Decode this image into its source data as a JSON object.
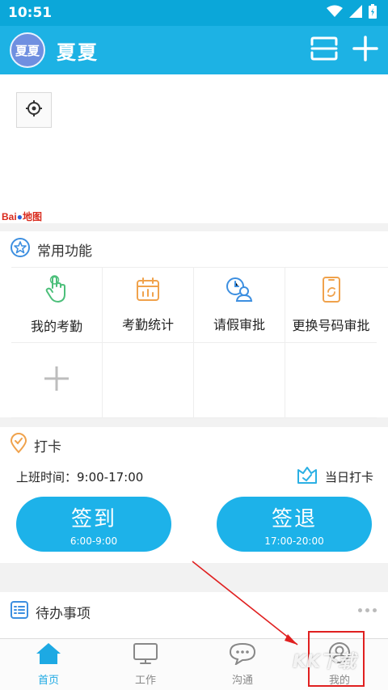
{
  "status_bar": {
    "time": "10:51"
  },
  "header": {
    "avatar_text": "夏夏",
    "user_name": "夏夏"
  },
  "map": {
    "logo_bai": "Bai",
    "logo_map": "地图"
  },
  "common_functions": {
    "title": "常用功能",
    "items": [
      {
        "label": "我的考勤",
        "icon": "hand-tap-icon"
      },
      {
        "label": "考勤统计",
        "icon": "calendar-chart-icon"
      },
      {
        "label": "请假审批",
        "icon": "clock-person-icon"
      },
      {
        "label": "更换号码审批",
        "icon": "phone-change-icon"
      }
    ],
    "add_icon": "plus-icon"
  },
  "checkin": {
    "title": "打卡",
    "work_hours": "上班时间：9:00-17:00",
    "today_label": "当日打卡",
    "sign_in": {
      "label": "签到",
      "time": "6:00-9:00"
    },
    "sign_out": {
      "label": "签退",
      "time": "17:00-20:00"
    }
  },
  "todo": {
    "title": "待办事项"
  },
  "nav": {
    "items": [
      {
        "label": "首页",
        "icon": "home-icon",
        "active": true
      },
      {
        "label": "工作",
        "icon": "monitor-icon",
        "active": false
      },
      {
        "label": "沟通",
        "icon": "chat-icon",
        "active": false
      },
      {
        "label": "我的",
        "icon": "person-icon",
        "active": false
      }
    ]
  },
  "watermark": "KK下载",
  "colors": {
    "primary": "#1db2e4",
    "status_bar": "#0ba7d9",
    "accent_orange": "#f0a24c",
    "annotation_red": "#e02020"
  }
}
